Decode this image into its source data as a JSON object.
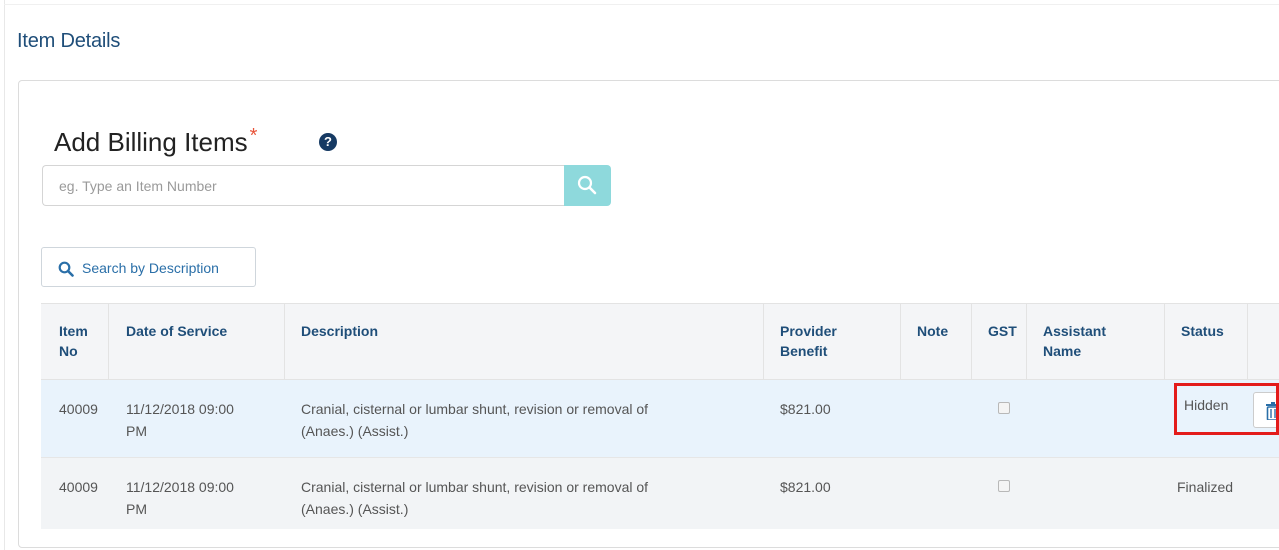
{
  "section": {
    "title": "Item Details"
  },
  "billing": {
    "title": "Add Billing Items",
    "required_mark": "*",
    "help_icon": "?",
    "search": {
      "placeholder": "eg. Type an Item Number",
      "value": ""
    },
    "search_by_description_label": "Search by Description"
  },
  "table": {
    "headers": {
      "item_no": [
        "Item",
        "No"
      ],
      "date": "Date of Service",
      "description": "Description",
      "provider_benefit": [
        "Provider",
        "Benefit"
      ],
      "note": "Note",
      "gst": "GST",
      "assistant_name": [
        "Assistant",
        "Name"
      ],
      "status": "Status"
    },
    "rows": [
      {
        "item_no": "40009",
        "date": [
          "11/12/2018 09:00",
          "PM"
        ],
        "description": [
          "Cranial, cisternal or lumbar shunt, revision or removal of",
          "(Anaes.) (Assist.)"
        ],
        "provider_benefit": "$821.00",
        "note": "",
        "gst_checked": false,
        "assistant_name": "",
        "status": "Hidden"
      },
      {
        "item_no": "40009",
        "date": [
          "11/12/2018 09:00",
          "PM"
        ],
        "description": [
          "Cranial, cisternal or lumbar shunt, revision or removal of",
          "(Anaes.) (Assist.)"
        ],
        "provider_benefit": "$821.00",
        "note": "",
        "gst_checked": false,
        "assistant_name": "",
        "status": "Finalized"
      }
    ]
  },
  "colors": {
    "title_blue": "#1f4e79",
    "link_blue": "#2a6fa8",
    "search_button": "#8ed9dc",
    "row_highlight": "#e9f3fc",
    "required_mark": "#e8543a",
    "annotation_red": "#e31b1b"
  },
  "icons": {
    "search_button_icon": "search-icon",
    "description_icon": "search-icon",
    "help": "question-circle-icon",
    "row_action": "trash-icon"
  }
}
